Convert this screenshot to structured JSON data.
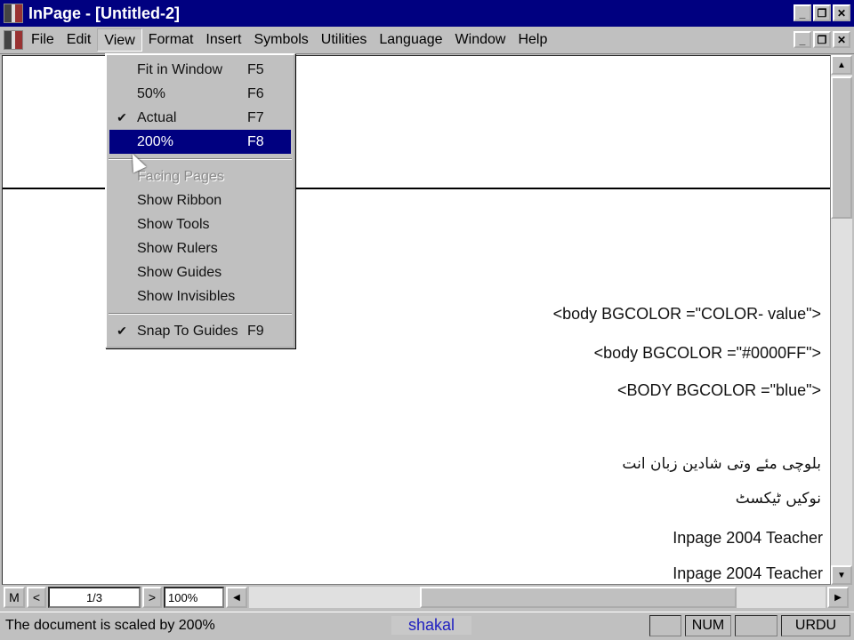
{
  "window": {
    "title": "InPage - [Untitled-2]"
  },
  "menubar": [
    "File",
    "Edit",
    "View",
    "Format",
    "Insert",
    "Symbols",
    "Utilities",
    "Language",
    "Window",
    "Help"
  ],
  "view_menu": [
    {
      "label": "Fit in Window",
      "key": "F5",
      "checked": false
    },
    {
      "label": "50%",
      "key": "F6",
      "checked": false
    },
    {
      "label": "Actual",
      "key": "F7",
      "checked": true
    },
    {
      "label": "200%",
      "key": "F8",
      "checked": false,
      "selected": true
    },
    {
      "label": "Facing Pages",
      "key": "",
      "disabled": true
    },
    {
      "label": "Show Ribbon",
      "key": ""
    },
    {
      "label": "Show Tools",
      "key": ""
    },
    {
      "label": "Show Rulers",
      "key": ""
    },
    {
      "label": "Show Guides",
      "key": ""
    },
    {
      "label": "Show Invisibles",
      "key": ""
    },
    {
      "label": "Snap To Guides",
      "key": "F9",
      "checked": true
    }
  ],
  "document": {
    "lines": [
      "<body BGCOLOR =\"COLOR- value\">",
      "<body BGCOLOR =\"#0000FF\">",
      "<BODY BGCOLOR =\"blue\">"
    ],
    "urdu": [
      "بلوچی مئے وتی شادین زبان انت",
      "نوکیں ٹیکسٹ"
    ],
    "teacher": [
      "Inpage  2004  Teacher",
      "Inpage  2004  Teacher"
    ]
  },
  "nav": {
    "master": "M",
    "prev": "<",
    "page": "1/3",
    "next": ">",
    "zoom": "100%"
  },
  "status": {
    "message": "The document is scaled by 200%",
    "font": "shakal",
    "num": "NUM",
    "language": "URDU"
  },
  "icons": {
    "check": "✔",
    "left": "◀",
    "right": "▶",
    "up": "▲",
    "down": "▼"
  }
}
